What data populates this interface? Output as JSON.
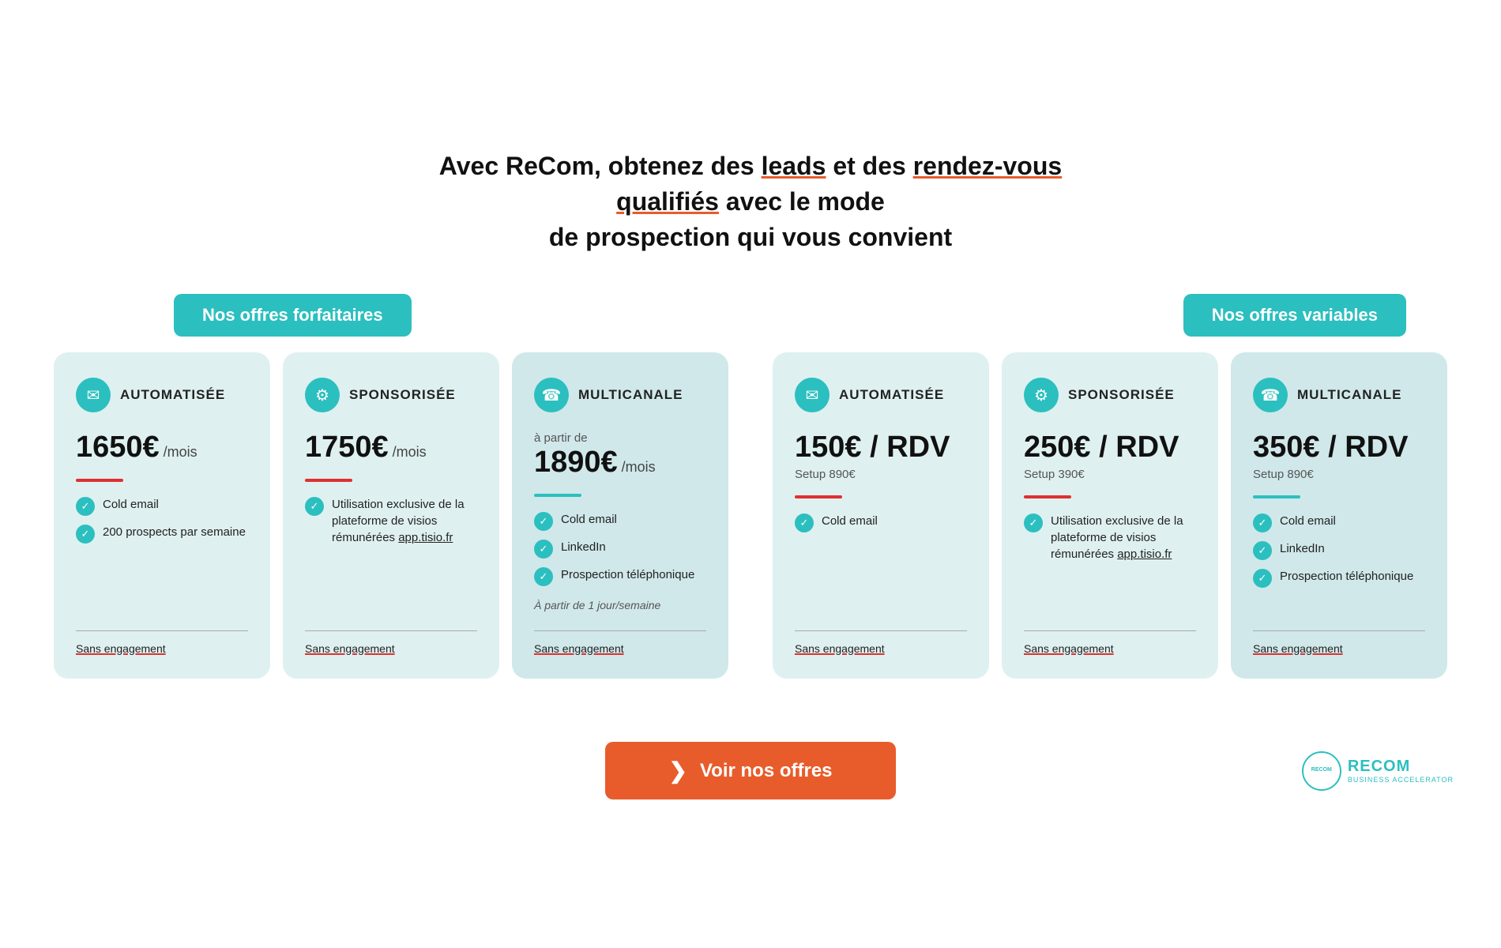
{
  "headline": {
    "part1": "Avec ReCom, obtenez des ",
    "link1": "leads",
    "part2": " et des ",
    "link2": "rendez-vous qualifiés",
    "part3": " avec le mode",
    "line2": "de prospection qui vous convient"
  },
  "sections": {
    "forfaitaires_label": "Nos offres forfaitaires",
    "variables_label": "Nos offres variables"
  },
  "forfaitaires": [
    {
      "id": "auto1",
      "icon": "✉",
      "title": "AUTOMATISÉE",
      "price": "1650€",
      "price_unit": "/mois",
      "divider": "red",
      "features": [
        {
          "text": "Cold email"
        },
        {
          "text": "200 prospects par semaine"
        }
      ],
      "footer": "Sans engagement"
    },
    {
      "id": "spon1",
      "icon": "⚙",
      "title": "SPONSORISÉE",
      "price": "1750€",
      "price_unit": "/mois",
      "divider": "red",
      "features": [
        {
          "text": "Utilisation exclusive de la plateforme de visios rémunérées app.tisio.fr",
          "link": "app.tisio.fr"
        }
      ],
      "footer": "Sans engagement"
    },
    {
      "id": "multi1",
      "icon": "☎",
      "title": "MULTICANALE",
      "price_prefix": "à partir de",
      "price": "1890€",
      "price_unit": "/mois",
      "divider": "blue",
      "features": [
        {
          "text": "Cold email"
        },
        {
          "text": "LinkedIn"
        },
        {
          "text": "Prospection téléphonique"
        }
      ],
      "feature_italic": "À partir de 1 jour/semaine",
      "footer": "Sans engagement"
    }
  ],
  "variables": [
    {
      "id": "auto2",
      "icon": "✉",
      "title": "AUTOMATISÉE",
      "price": "150€ / RDV",
      "price_sub": "Setup 890€",
      "divider": "red",
      "features": [
        {
          "text": "Cold email"
        }
      ],
      "footer": "Sans engagement"
    },
    {
      "id": "spon2",
      "icon": "⚙",
      "title": "SPONSORISÉE",
      "price": "250€ / RDV",
      "price_sub": "Setup 390€",
      "divider": "red",
      "features": [
        {
          "text": "Utilisation exclusive de la plateforme de visios rémunérées app.tisio.fr",
          "link": "app.tisio.fr"
        }
      ],
      "footer": "Sans engagement"
    },
    {
      "id": "multi2",
      "icon": "☎",
      "title": "MULTICANALE",
      "price": "350€ / RDV",
      "price_sub": "Setup 890€",
      "divider": "blue",
      "features": [
        {
          "text": "Cold email"
        },
        {
          "text": "LinkedIn"
        },
        {
          "text": "Prospection téléphonique"
        }
      ],
      "footer": "Sans engagement"
    }
  ],
  "cta": {
    "button_label": "Voir nos offres",
    "arrow": "❯"
  },
  "brand": {
    "name": "RECOM",
    "sub": "BUSINESS ACCELERATOR"
  }
}
